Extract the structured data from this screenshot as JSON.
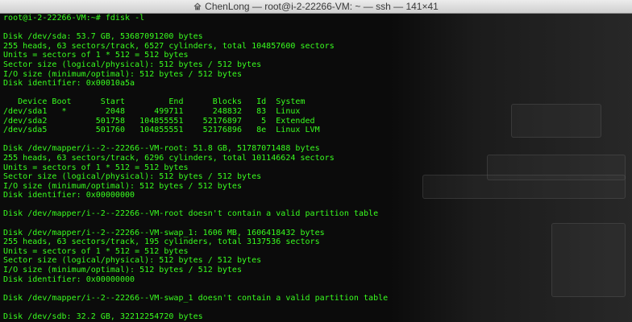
{
  "window": {
    "title": "ChenLong — root@i-2-22266-VM: ~ — ssh — 141×41",
    "title_icon": "home-folder-icon",
    "colors": {
      "terminal_bg": "#0b0b0b",
      "terminal_text": "#39ff1f",
      "titlebar": "#dcdcdc"
    }
  },
  "terminal": {
    "lines": [
      "root@i-2-22266-VM:~# fdisk -l",
      "",
      "Disk /dev/sda: 53.7 GB, 53687091200 bytes",
      "255 heads, 63 sectors/track, 6527 cylinders, total 104857600 sectors",
      "Units = sectors of 1 * 512 = 512 bytes",
      "Sector size (logical/physical): 512 bytes / 512 bytes",
      "I/O size (minimum/optimal): 512 bytes / 512 bytes",
      "Disk identifier: 0x00010a5a",
      "",
      "   Device Boot      Start         End      Blocks   Id  System",
      "/dev/sda1   *        2048      499711      248832   83  Linux",
      "/dev/sda2          501758   104855551    52176897    5  Extended",
      "/dev/sda5          501760   104855551    52176896   8e  Linux LVM",
      "",
      "Disk /dev/mapper/i--2--22266--VM-root: 51.8 GB, 51787071488 bytes",
      "255 heads, 63 sectors/track, 6296 cylinders, total 101146624 sectors",
      "Units = sectors of 1 * 512 = 512 bytes",
      "Sector size (logical/physical): 512 bytes / 512 bytes",
      "I/O size (minimum/optimal): 512 bytes / 512 bytes",
      "Disk identifier: 0x00000000",
      "",
      "Disk /dev/mapper/i--2--22266--VM-root doesn't contain a valid partition table",
      "",
      "Disk /dev/mapper/i--2--22266--VM-swap_1: 1606 MB, 1606418432 bytes",
      "255 heads, 63 sectors/track, 195 cylinders, total 3137536 sectors",
      "Units = sectors of 1 * 512 = 512 bytes",
      "Sector size (logical/physical): 512 bytes / 512 bytes",
      "I/O size (minimum/optimal): 512 bytes / 512 bytes",
      "Disk identifier: 0x00000000",
      "",
      "Disk /dev/mapper/i--2--22266--VM-swap_1 doesn't contain a valid partition table",
      "",
      "Disk /dev/sdb: 32.2 GB, 32212254720 bytes"
    ]
  }
}
